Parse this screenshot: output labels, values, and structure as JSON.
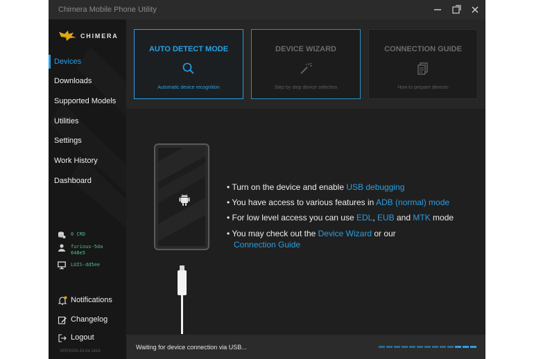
{
  "window": {
    "title": "Chimera Mobile Phone Utility",
    "minimize_icon": "minimize-icon",
    "maximize_icon": "maximize-icon",
    "close_icon": "close-icon"
  },
  "brand": {
    "name": "CHIMERA",
    "logo_icon": "chimera-logo"
  },
  "sidebar": {
    "items": [
      {
        "label": "Devices",
        "active": true
      },
      {
        "label": "Downloads"
      },
      {
        "label": "Supported Models"
      },
      {
        "label": "Utilities"
      },
      {
        "label": "Settings"
      },
      {
        "label": "Work History"
      },
      {
        "label": "Dashboard"
      }
    ],
    "account": {
      "credits": "0 CRD",
      "username": "furious-5da\n648e5",
      "machine": "LUIS-dd5ee"
    },
    "bottom": {
      "notifications": "Notifications",
      "changelog": "Changelog",
      "logout": "Logout"
    },
    "version": "VERSION 43.04.1616"
  },
  "cards": [
    {
      "title": "AUTO DETECT MODE",
      "subtitle": "Automatic device recognition",
      "icon": "search-icon",
      "state": "active"
    },
    {
      "title": "DEVICE WIZARD",
      "subtitle": "Step by step device selection",
      "icon": "magic-wand-icon",
      "state": "highlighted"
    },
    {
      "title": "CONNECTION GUIDE",
      "subtitle": "How to prepare devices",
      "icon": "document-icon",
      "state": "normal"
    }
  ],
  "instructions": {
    "b1_text": "Turn on the device and enable ",
    "b1_link": "USB debugging",
    "b2_text": "You have access to various features in ",
    "b2_link": "ADB (normal) mode",
    "b3_text": "For low level access you can use ",
    "b3_link1": "EDL",
    "b3_sep1": ", ",
    "b3_link2": "EUB",
    "b3_sep2": " and ",
    "b3_link3": "MTK",
    "b3_end": " mode",
    "b4_text": "You may check out the ",
    "b4_link1": "Device Wizard",
    "b4_mid": " or our",
    "b4_link2": "Connection Guide"
  },
  "status": {
    "text": "Waiting for device connection via USB...",
    "accent_color": "#2aa0e6"
  }
}
